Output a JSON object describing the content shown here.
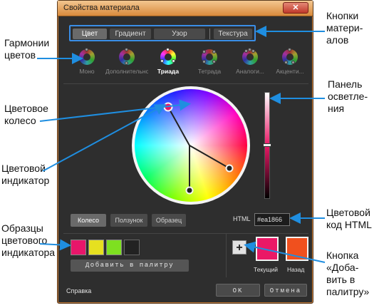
{
  "window": {
    "title": "Свойства материала",
    "close_symbol": "✕"
  },
  "material_buttons": [
    "Цвет",
    "Градиент",
    "Узор",
    "Текстура"
  ],
  "material_active": 0,
  "harmonies": [
    "Моно",
    "Дополнительно",
    "Триада",
    "Тетрада",
    "Аналоги...",
    "Акценти..."
  ],
  "harmony_active": 2,
  "modes": [
    "Колесо",
    "Ползунок",
    "Образец"
  ],
  "mode_active": 0,
  "html": {
    "label": "HTML",
    "value": "#ea1866"
  },
  "swatches": [
    "#e8166a",
    "#e6e020",
    "#7ee020",
    ""
  ],
  "add_to_palette": "Добавить в палитру",
  "current": {
    "label": "Текущий",
    "color": "#ea1866"
  },
  "previous": {
    "label": "Назад",
    "color": "#f0501e"
  },
  "plus_symbol": "+",
  "help": "Справка",
  "ok": "OK",
  "cancel": "Отмена",
  "callouts": {
    "material_buttons": "Кнопки\nматери-\nалов",
    "harmonies": "Гармонии\nцветов",
    "brightness": "Панель\nосветле-\nния",
    "wheel": "Цветовое\nколесо",
    "indicator": "Цветовой\nиндикатор",
    "html_code": "Цветовой\nкод HTML",
    "samples": "Образцы\nцветового\nиндикатора",
    "add_button": "Кнопка\n«Доба-\nвить в\nпалитру»"
  },
  "colors": {
    "accent": "#3a8ee6",
    "panel": "#2e2e2e",
    "titlebar": "#d98a3c"
  }
}
